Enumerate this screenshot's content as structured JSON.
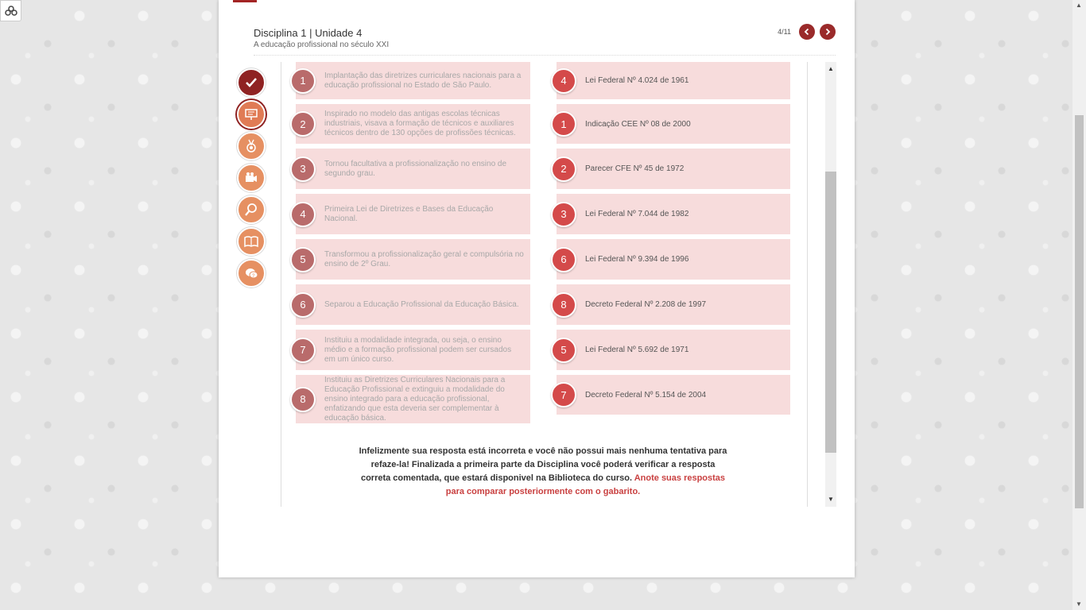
{
  "header": {
    "course_title": "Disciplina 1 | Unidade 4",
    "unit_subtitle": "A educação profissional no século XXI",
    "page_indicator": "4/11"
  },
  "left_items": [
    {
      "number": "1",
      "text": "Implantação das diretrizes curriculares nacionais para a educação profissional no Estado de São Paulo."
    },
    {
      "number": "2",
      "text": "Inspirado no modelo das antigas escolas técnicas industriais, visava a formação de técnicos e auxiliares técnicos dentro de 130 opções de profissões técnicas."
    },
    {
      "number": "3",
      "text": "Tornou facultativa a profissionalização no ensino de segundo grau."
    },
    {
      "number": "4",
      "text": "Primeira Lei de Diretrizes e Bases da Educação Nacional."
    },
    {
      "number": "5",
      "text": "Transformou a profissionalização geral e compulsória no ensino de 2º Grau."
    },
    {
      "number": "6",
      "text": "Separou a Educação Profissional da Educação Básica."
    },
    {
      "number": "7",
      "text": "Instituiu a modalidade integrada, ou seja, o ensino médio e a formação profissional podem ser cursados em um único curso."
    },
    {
      "number": "8",
      "text": "Instituiu as Diretrizes Curriculares Nacionais para a Educação Profissional e extinguiu a modalidade do ensino integrado para a educação profissional, enfatizando que esta deveria ser complementar à educação básica."
    }
  ],
  "right_items": [
    {
      "number": "4",
      "text": "Lei Federal Nº 4.024 de 1961"
    },
    {
      "number": "1",
      "text": "Indicação CEE Nº 08 de 2000"
    },
    {
      "number": "2",
      "text": "Parecer CFE Nº 45 de 1972"
    },
    {
      "number": "3",
      "text": "Lei Federal Nº 7.044 de 1982"
    },
    {
      "number": "6",
      "text": "Lei Federal Nº 9.394 de 1996"
    },
    {
      "number": "8",
      "text": "Decreto Federal Nº 2.208 de 1997"
    },
    {
      "number": "5",
      "text": "Lei Federal Nº 5.692 de 1971"
    },
    {
      "number": "7",
      "text": "Decreto Federal Nº 5.154 de 2004"
    }
  ],
  "feedback": {
    "message": "Infelizmente sua resposta está incorreta e você não possui mais nenhuma tentativa para refaze-la! Finalizada a primeira parte da Disciplina você poderá verificar a resposta correta comentada, que estará disponivel na Biblioteca do curso.",
    "highlight": "Anote suas respostas para comparar posteriormente com o gabarito."
  },
  "side_nav": [
    {
      "icon": "check-icon",
      "state": "active"
    },
    {
      "icon": "presentation-icon",
      "state": "current"
    },
    {
      "icon": "medal-icon",
      "state": "normal"
    },
    {
      "icon": "video-camera-icon",
      "state": "normal"
    },
    {
      "icon": "magnifier-icon",
      "state": "normal"
    },
    {
      "icon": "book-icon",
      "state": "normal"
    },
    {
      "icon": "chat-question-icon",
      "state": "normal"
    }
  ],
  "colors": {
    "brand": "#9a2a2a",
    "item_background": "#f7dcdc",
    "left_circle": "#b96b6b",
    "right_circle": "#d44a4a",
    "highlight_text": "#c94040"
  }
}
